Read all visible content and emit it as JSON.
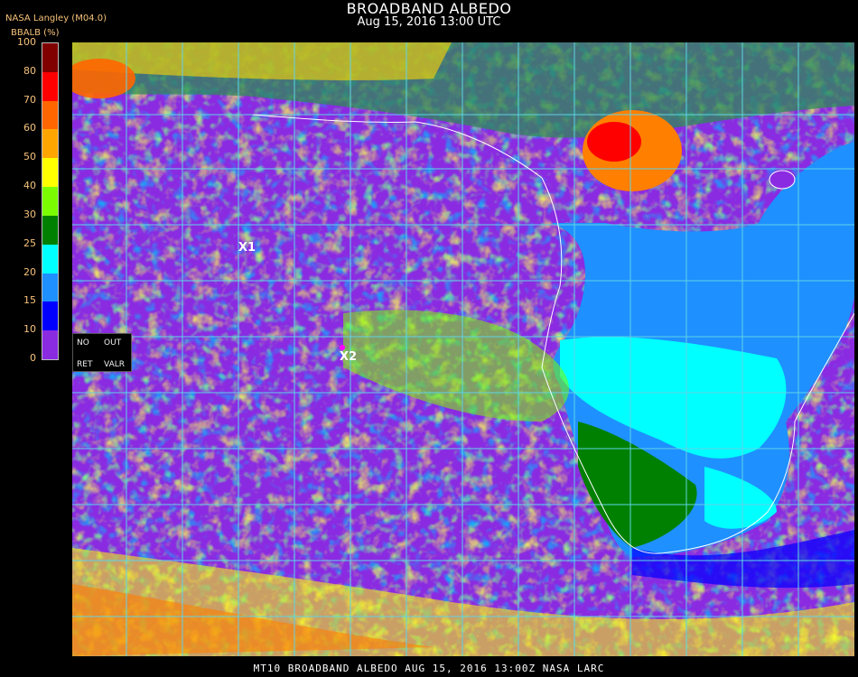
{
  "header": {
    "title": "BROADBAND ALBEDO",
    "subtitle": "Aug 15, 2016 13:00 UTC",
    "source": "NASA Langley (M04.0)",
    "unit_label": "BBALB (%)"
  },
  "color_scale": {
    "ticks": [
      "100",
      "80",
      "70",
      "60",
      "50",
      "40",
      "30",
      "25",
      "20",
      "15",
      "10",
      "0"
    ],
    "bands": [
      {
        "from": 0,
        "to": 10,
        "color": "#8a2be2"
      },
      {
        "from": 10,
        "to": 15,
        "color": "#0000ff"
      },
      {
        "from": 15,
        "to": 20,
        "color": "#1e90ff"
      },
      {
        "from": 20,
        "to": 25,
        "color": "#00ffff"
      },
      {
        "from": 25,
        "to": 30,
        "color": "#008000"
      },
      {
        "from": 30,
        "to": 40,
        "color": "#7cfc00"
      },
      {
        "from": 40,
        "to": 50,
        "color": "#ffff00"
      },
      {
        "from": 50,
        "to": 60,
        "color": "#ffa500"
      },
      {
        "from": 60,
        "to": 70,
        "color": "#ff6600"
      },
      {
        "from": 70,
        "to": 80,
        "color": "#ff0000"
      },
      {
        "from": 80,
        "to": 100,
        "color": "#800000"
      }
    ]
  },
  "legend": {
    "no": "NO",
    "out": "OUT",
    "ret": "RET",
    "valr": "VALR"
  },
  "markers": {
    "x1": "X1",
    "x2": "X2"
  },
  "footer": "MT10  BROADBAND ALBEDO   AUG 15, 2016 13:00Z   NASA LARC"
}
